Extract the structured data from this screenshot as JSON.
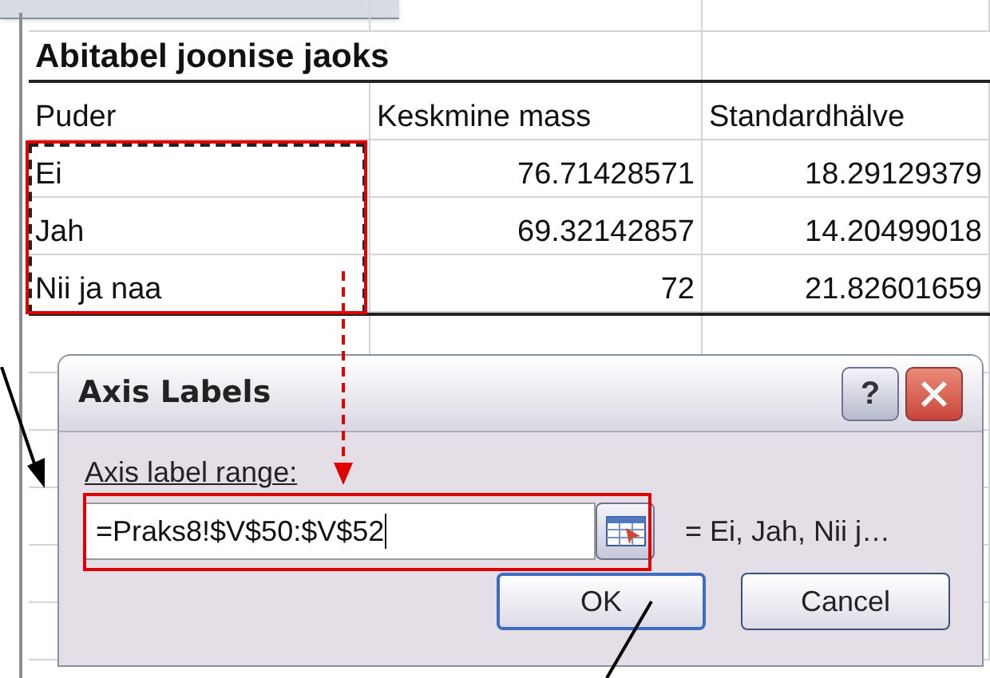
{
  "sheet": {
    "title": "Abitabel joonise jaoks",
    "columns": [
      "Puder",
      "Keskmine mass",
      "Standardhälve"
    ],
    "rows": [
      [
        "Ei",
        "76.71428571",
        "18.29129379"
      ],
      [
        "Jah",
        "69.32142857",
        "14.20499018"
      ],
      [
        "Nii ja naa",
        "72",
        "21.82601659"
      ]
    ]
  },
  "dialog": {
    "title": "Axis Labels",
    "help_button": "?",
    "field_label": "Axis label range:",
    "value": "=Praks8!$V$50:$V$52",
    "preview": "= Ei, Jah, Nii j…",
    "buttons": [
      {
        "label": "OK",
        "default": true
      },
      {
        "label": "Cancel",
        "default": false
      }
    ]
  }
}
